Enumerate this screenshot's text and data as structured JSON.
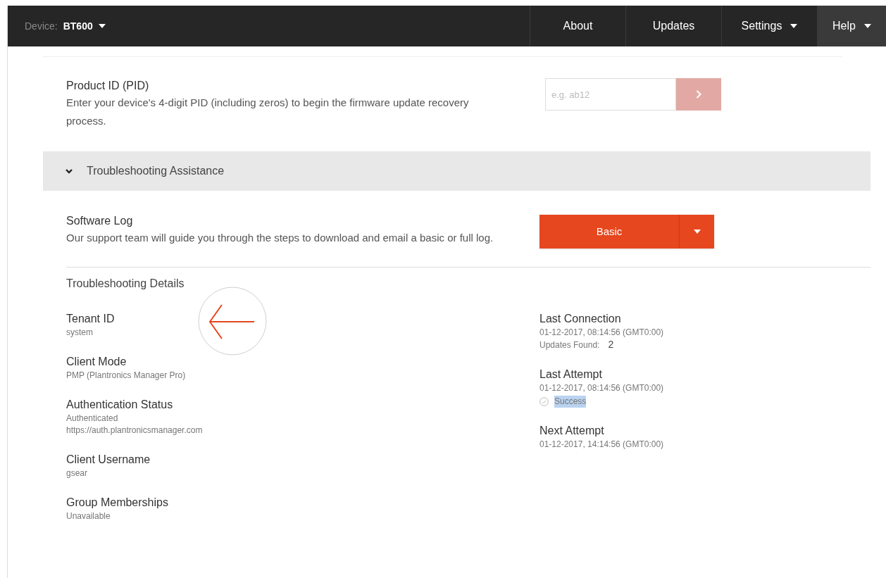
{
  "navbar": {
    "device_label": "Device:",
    "device_name": "BT600",
    "items": [
      {
        "label": "About",
        "dropdown": false,
        "selected": false
      },
      {
        "label": "Updates",
        "dropdown": false,
        "selected": false
      },
      {
        "label": "Settings",
        "dropdown": true,
        "selected": false
      },
      {
        "label": "Help",
        "dropdown": true,
        "selected": true
      }
    ]
  },
  "pid": {
    "title": "Product ID (PID)",
    "description": "Enter your device's 4-digit PID (including zeros) to begin the firmware update recovery process.",
    "placeholder": "e.g. ab12",
    "submit_disabled": true
  },
  "section": {
    "title": "Troubleshooting Assistance",
    "expanded": true
  },
  "software_log": {
    "title": "Software Log",
    "description": "Our support team will guide you through the steps to download and email a basic or full log.",
    "button": "Basic"
  },
  "details": {
    "title": "Troubleshooting Details",
    "left": [
      {
        "label": "Tenant ID",
        "lines": [
          {
            "kind": "text",
            "text": "system"
          }
        ]
      },
      {
        "label": "Client Mode",
        "lines": [
          {
            "kind": "text",
            "text": "PMP (Plantronics Manager Pro)"
          }
        ]
      },
      {
        "label": "Authentication Status",
        "lines": [
          {
            "kind": "text",
            "text": "Authenticated"
          },
          {
            "kind": "text",
            "text": "https://auth.plantronicsmanager.com"
          }
        ]
      },
      {
        "label": "Client Username",
        "lines": [
          {
            "kind": "text",
            "text": "gsear"
          }
        ]
      },
      {
        "label": "Group Memberships",
        "lines": [
          {
            "kind": "text",
            "text": "Unavailable"
          }
        ]
      }
    ],
    "right": [
      {
        "label": "Last Connection",
        "lines": [
          {
            "kind": "text",
            "text": "01-12-2017, 08:14:56 (GMT0:00)"
          },
          {
            "kind": "count",
            "text": "Updates Found:",
            "value": "2"
          }
        ]
      },
      {
        "label": "Last Attempt",
        "lines": [
          {
            "kind": "text",
            "text": "01-12-2017, 08:14:56 (GMT0:00)"
          },
          {
            "kind": "status",
            "text": "Success",
            "highlighted": true
          }
        ]
      },
      {
        "label": "Next Attempt",
        "lines": [
          {
            "kind": "text",
            "text": "01-12-2017, 14:14:56 (GMT0:00)"
          }
        ]
      }
    ]
  }
}
